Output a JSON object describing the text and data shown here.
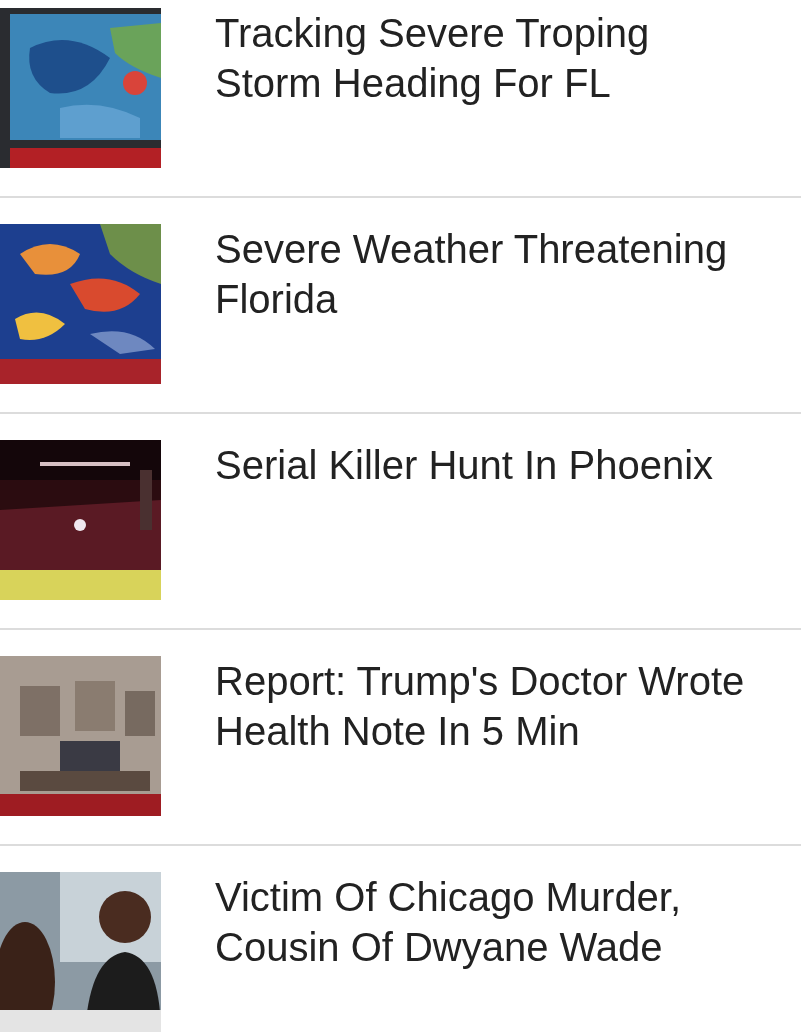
{
  "videos": [
    {
      "title": "Tracking Severe Troping Storm Heading For FL"
    },
    {
      "title": "Severe Weather Threatening Florida"
    },
    {
      "title": "Serial Killer Hunt In Phoenix"
    },
    {
      "title": "Report: Trump's Doctor Wrote Health Note In 5 Min"
    },
    {
      "title": "Victim Of Chicago Murder, Cousin Of Dwyane Wade"
    }
  ]
}
